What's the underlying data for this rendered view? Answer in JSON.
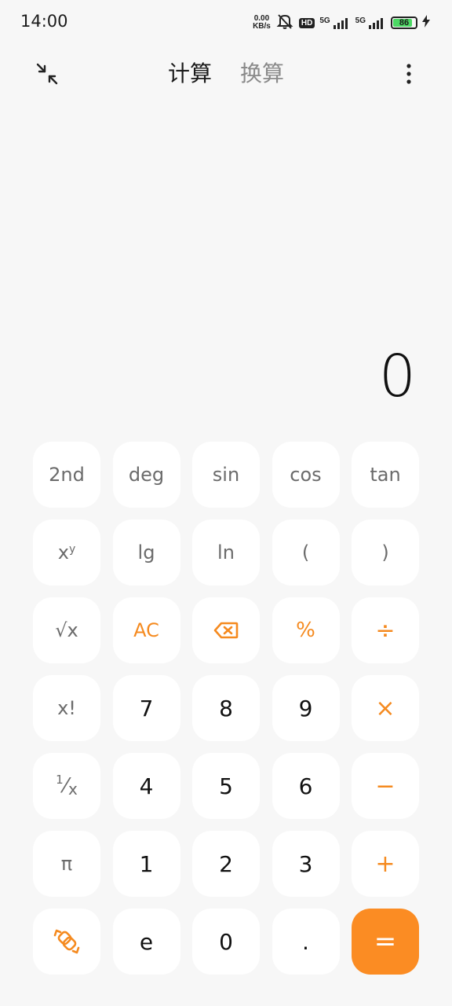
{
  "status_bar": {
    "time": "14:00",
    "net_speed_value": "0.00",
    "net_speed_unit": "KB/s",
    "hd_label": "HD",
    "sim1_label": "5G",
    "sim2_label": "5G",
    "battery_level": "86",
    "battery_fraction": 0.86,
    "battery_color": "#4cd964"
  },
  "header": {
    "tabs": [
      {
        "label": "计算",
        "active": true
      },
      {
        "label": "换算",
        "active": false
      }
    ]
  },
  "display": {
    "value": "0"
  },
  "keypad": {
    "accent_color": "#f58a1f",
    "equals_bg": "#fb8c23",
    "rows": [
      [
        "2nd",
        "deg",
        "sin",
        "cos",
        "tan"
      ],
      [
        "xʸ",
        "lg",
        "ln",
        "(",
        ")"
      ],
      [
        "√x",
        "AC",
        "backspace",
        "%",
        "÷"
      ],
      [
        "x!",
        "7",
        "8",
        "9",
        "×"
      ],
      [
        "1/x",
        "4",
        "5",
        "6",
        "−"
      ],
      [
        "π",
        "1",
        "2",
        "3",
        "+"
      ],
      [
        "switch",
        "e",
        "0",
        ".",
        "="
      ]
    ],
    "labels": {
      "second": "2nd",
      "deg": "deg",
      "sin": "sin",
      "cos": "cos",
      "tan": "tan",
      "power_base": "x",
      "power_exp": "y",
      "lg": "lg",
      "ln": "ln",
      "lparen": "(",
      "rparen": ")",
      "sqrt": "√x",
      "ac": "AC",
      "percent": "%",
      "divide": "÷",
      "factorial": "x!",
      "seven": "7",
      "eight": "8",
      "nine": "9",
      "multiply": "×",
      "recip_num": "1",
      "recip_den": "x",
      "four": "4",
      "five": "5",
      "six": "6",
      "minus": "−",
      "pi": "π",
      "one": "1",
      "two": "2",
      "three": "3",
      "plus": "+",
      "e": "e",
      "zero": "0",
      "dot": ".",
      "equals": "="
    }
  }
}
